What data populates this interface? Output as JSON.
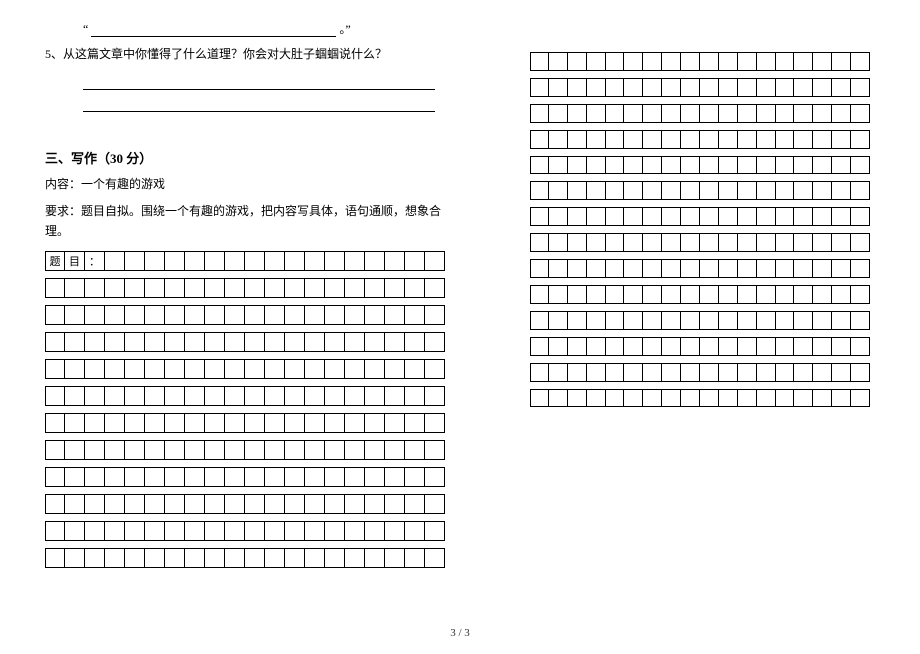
{
  "quote_open": "“",
  "quote_end": "。”",
  "question_5": "5、从这篇文章中你懂得了什么道理？你会对大肚子蝈蝈说什么？",
  "section_heading": "三、写作（30 分）",
  "content_label": "内容：一个有趣的游戏",
  "requirement": "要求：题目自拟。围绕一个有趣的游戏，把内容写具体，语句通顺，想象合理。",
  "title_chars": [
    "题",
    "目",
    "："
  ],
  "page_number": "3 / 3",
  "grids": {
    "left_title_cols": 20,
    "left_rows": 11,
    "left_cols": 20,
    "right_rows": 14,
    "right_cols": 18
  }
}
